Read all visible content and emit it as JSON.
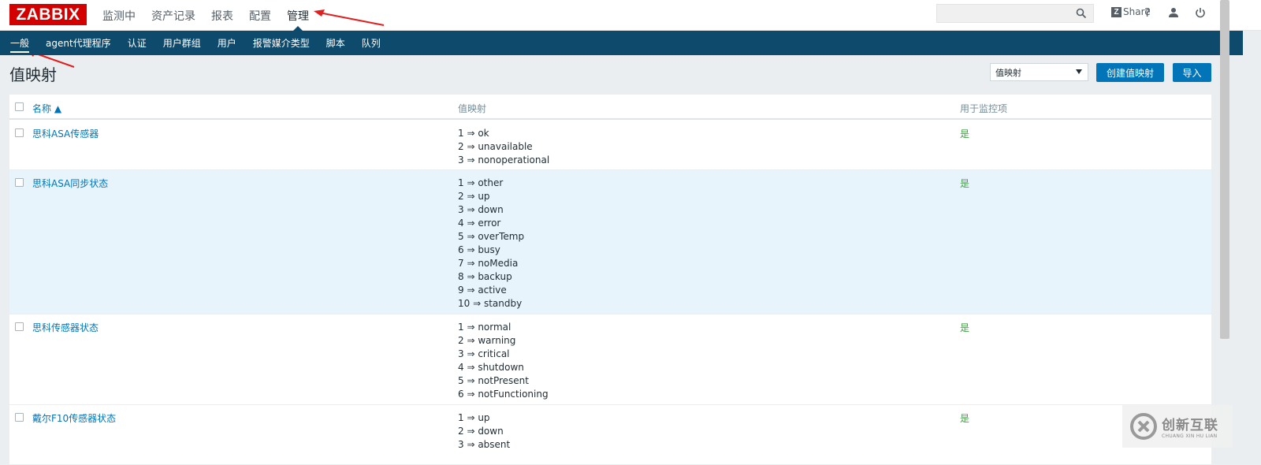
{
  "app": {
    "logo_text": "ZABBIX",
    "brand_color": "#d40000",
    "nav_color": "#0d4a6b",
    "accent_color": "#0275b8",
    "status_yes_color": "#429e47"
  },
  "top_nav": {
    "items": [
      {
        "label": "监测中"
      },
      {
        "label": "资产记录"
      },
      {
        "label": "报表"
      },
      {
        "label": "配置"
      },
      {
        "label": "管理"
      }
    ],
    "active_index": 4
  },
  "header_right": {
    "search_placeholder": "",
    "search_icon": "search-icon",
    "share_label": "Share",
    "share_badge": "Z",
    "help_label": "?",
    "icons": [
      "search-icon",
      "help-icon",
      "user-icon",
      "power-icon"
    ]
  },
  "sub_nav": {
    "items": [
      {
        "label": "一般"
      },
      {
        "label": "agent代理程序"
      },
      {
        "label": "认证"
      },
      {
        "label": "用户群组"
      },
      {
        "label": "用户"
      },
      {
        "label": "报警媒介类型"
      },
      {
        "label": "脚本"
      },
      {
        "label": "队列"
      }
    ],
    "active_index": 0
  },
  "page": {
    "title": "值映射",
    "select_value": "值映射",
    "create_button": "创建值映射",
    "import_button": "导入"
  },
  "table": {
    "columns": {
      "name": "名称 ▲",
      "mappings": "值映射",
      "used": "用于监控项"
    },
    "rows": [
      {
        "name": "思科ASA传感器",
        "mappings": [
          "1 ⇒ ok",
          "2 ⇒ unavailable",
          "3 ⇒ nonoperational"
        ],
        "used": "是"
      },
      {
        "name": "思科ASA同步状态",
        "mappings": [
          "1 ⇒ other",
          "2 ⇒ up",
          "3 ⇒ down",
          "4 ⇒ error",
          "5 ⇒ overTemp",
          "6 ⇒ busy",
          "7 ⇒ noMedia",
          "8 ⇒ backup",
          "9 ⇒ active",
          "10 ⇒ standby"
        ],
        "used": "是"
      },
      {
        "name": "思科传感器状态",
        "mappings": [
          "1 ⇒ normal",
          "2 ⇒ warning",
          "3 ⇒ critical",
          "4 ⇒ shutdown",
          "5 ⇒ notPresent",
          "6 ⇒ notFunctioning"
        ],
        "used": "是"
      },
      {
        "name": "戴尔F10传感器状态",
        "mappings": [
          "1 ⇒ up",
          "2 ⇒ down",
          "3 ⇒ absent"
        ],
        "used": "是"
      }
    ]
  },
  "watermark": {
    "title": "创新互联",
    "subtitle": "CHUANG XIN HU LIAN"
  }
}
